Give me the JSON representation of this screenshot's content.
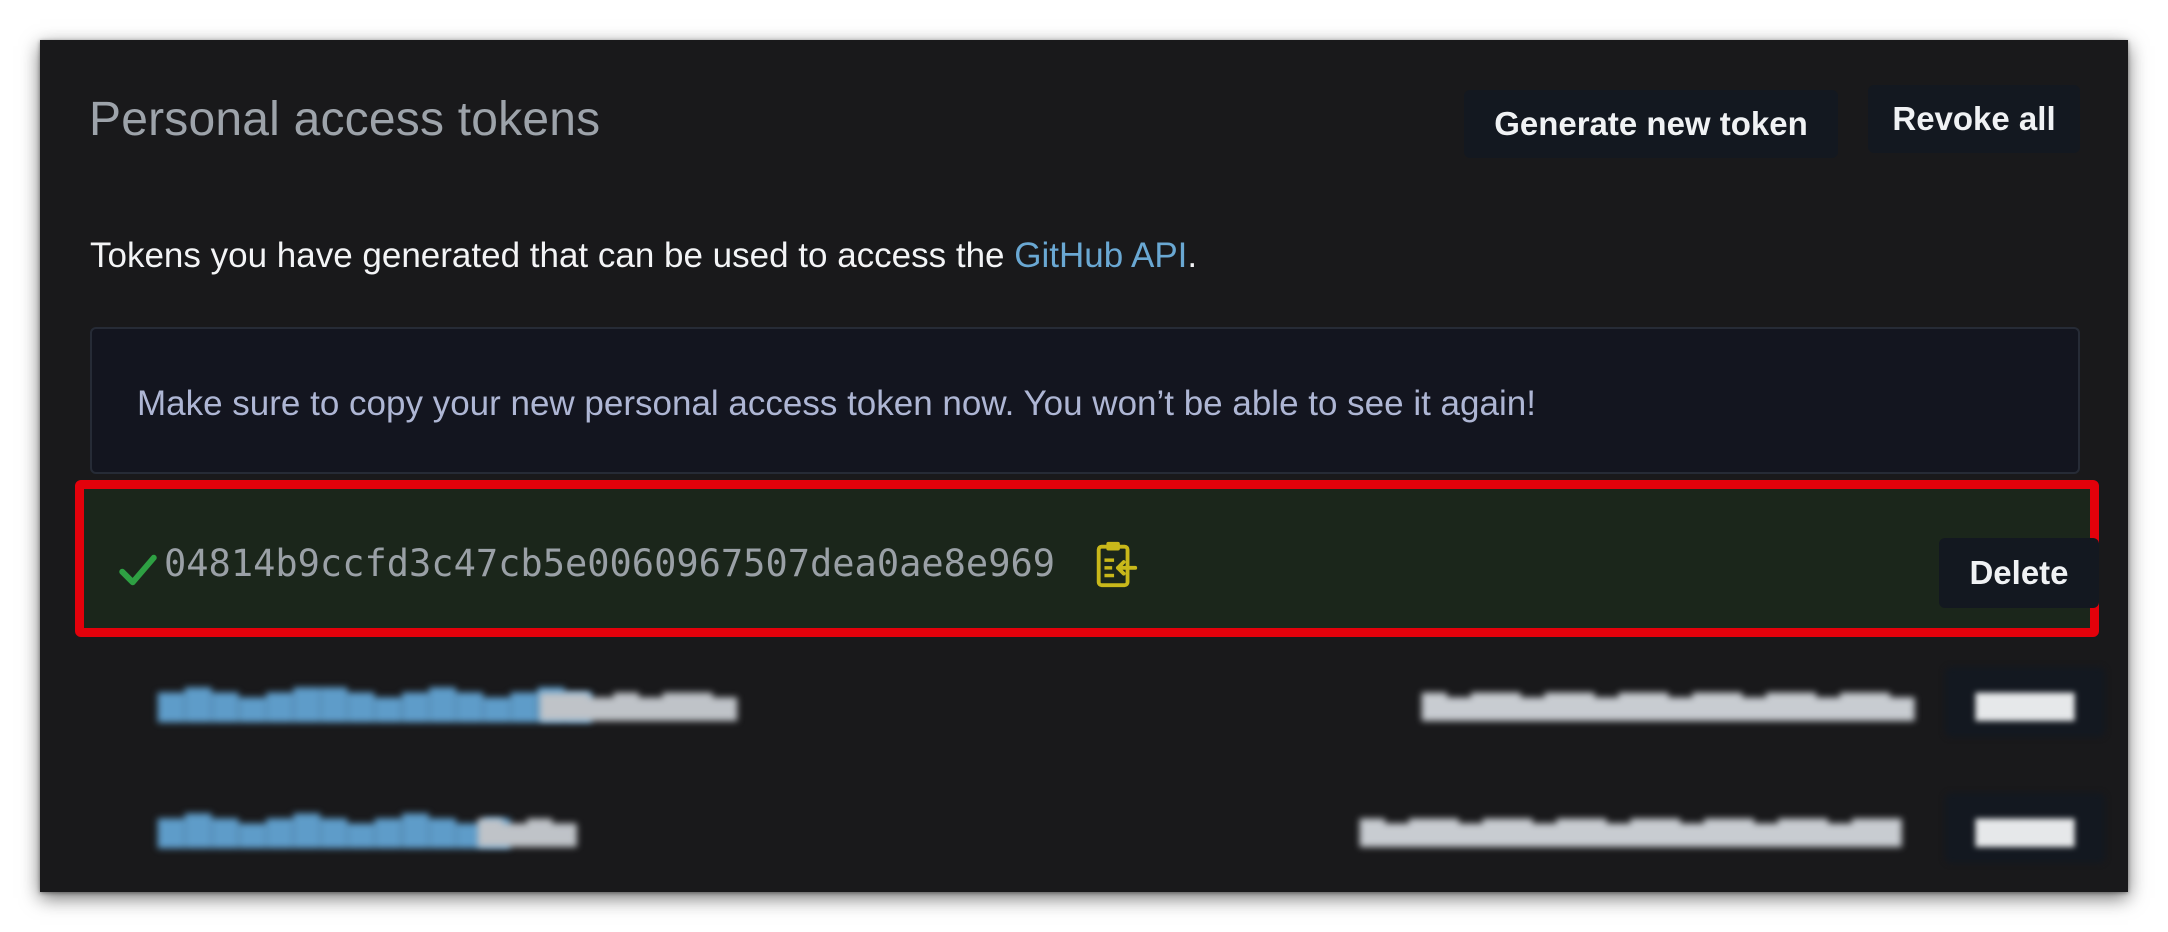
{
  "header": {
    "title": "Personal access tokens",
    "generate_label": "Generate new token",
    "revoke_label": "Revoke all"
  },
  "description": {
    "prefix": "Tokens you have generated that can be used to access the ",
    "link": "GitHub API",
    "suffix": "."
  },
  "notice": {
    "text": "Make sure to copy your new personal access token now. You won’t be able to see it again!"
  },
  "new_token": {
    "value": "04814b9ccfd3c47cb5e0060967507dea0ae8e969",
    "delete_label": "Delete",
    "icons": [
      "check-icon",
      "clipboard-copy-icon"
    ]
  },
  "colors": {
    "panel_bg": "#19191b",
    "link": "#6aa8d3",
    "highlight_border": "#e3010b",
    "check": "#2ea043",
    "clipboard": "#c9b81a"
  }
}
